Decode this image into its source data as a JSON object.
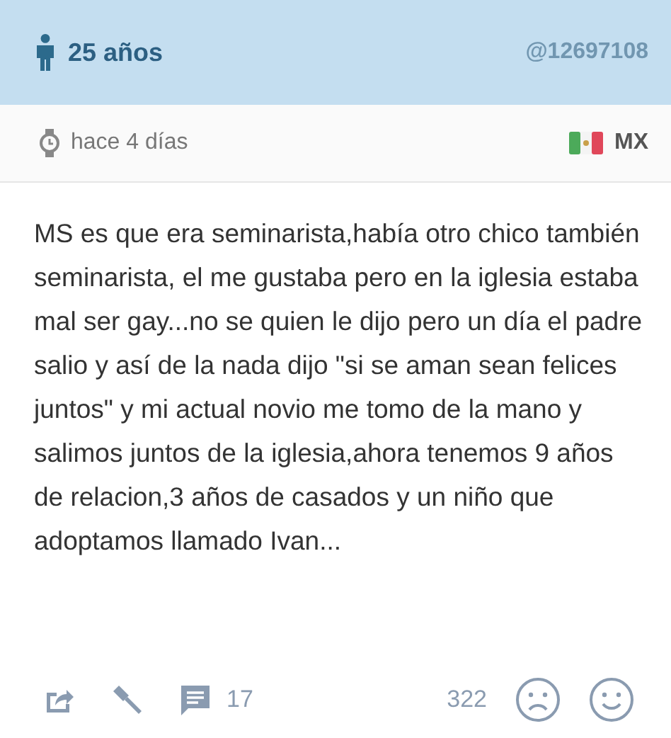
{
  "header": {
    "age": "25 años",
    "handle": "@12697108"
  },
  "meta": {
    "time": "hace 4 días",
    "country": "MX"
  },
  "post": {
    "text": "MS es que era seminarista,había otro chico también seminarista, el me gustaba pero en la iglesia estaba mal ser gay...no se quien le dijo pero un día el padre salio y así de la nada dijo \"si se aman sean felices juntos\" y mi actual novio me tomo de la mano y salimos juntos de la iglesia,ahora tenemos 9 años de relacion,3 años de casados y un niño que adoptamos llamado Ivan..."
  },
  "footer": {
    "comments": "17",
    "votes": "322"
  }
}
